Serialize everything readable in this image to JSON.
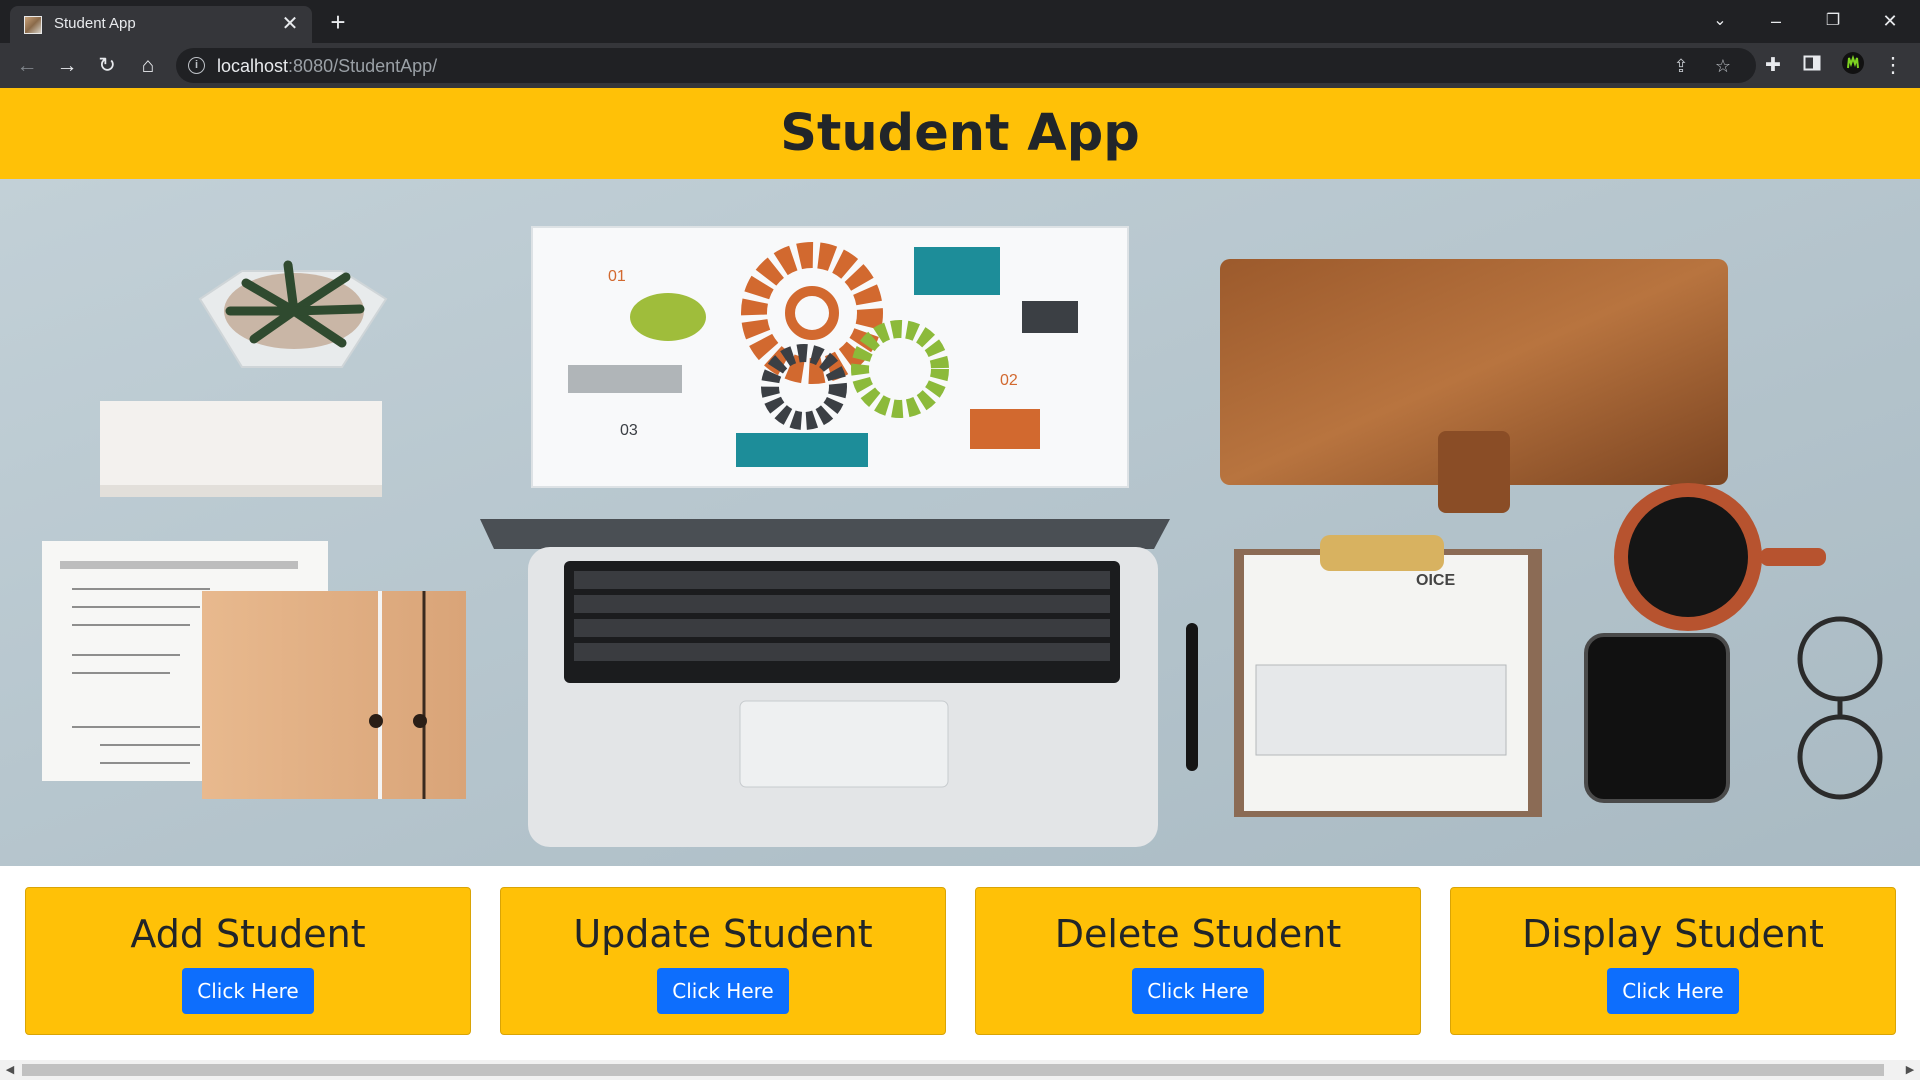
{
  "browser": {
    "tab_title": "Student App",
    "url_host": "localhost",
    "url_path": ":8080/StudentApp/"
  },
  "header": {
    "title": "Student App"
  },
  "cards": [
    {
      "title": "Add Student",
      "button": "Click Here"
    },
    {
      "title": "Update Student",
      "button": "Click Here"
    },
    {
      "title": "Delete Student",
      "button": "Click Here"
    },
    {
      "title": "Display Student",
      "button": "Click Here"
    }
  ],
  "colors": {
    "header_bg": "#ffc107",
    "button_bg": "#0d6efd",
    "browser_dark": "#202124"
  }
}
